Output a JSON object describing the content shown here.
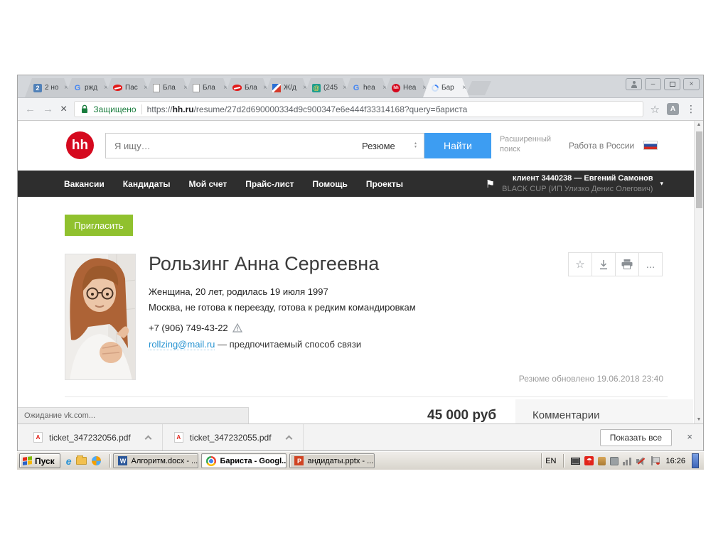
{
  "icons": {
    "close": "×",
    "star": "☆",
    "menu": "⋮",
    "flag": "⚑",
    "back": "←",
    "forward": "→",
    "caret_down": "▾",
    "spin_up": "▴",
    "spin_down": "▾",
    "minimize": "–",
    "more": "...",
    "g": "G",
    "at": "@",
    "hh": "hh",
    "e": "e",
    "w": "W",
    "p": "P",
    "a": "A",
    "badge2": "2",
    "umbrella": "☂",
    "scroll_up": "▲",
    "scroll_down": "▼"
  },
  "browser": {
    "tabs": [
      {
        "label": "2 но"
      },
      {
        "label": "ржд"
      },
      {
        "label": "Пас"
      },
      {
        "label": "Бла"
      },
      {
        "label": "Бла"
      },
      {
        "label": "Бла"
      },
      {
        "label": "Ж/д"
      },
      {
        "label": "(245"
      },
      {
        "label": "hea"
      },
      {
        "label": "Hea"
      },
      {
        "label": "Бар"
      }
    ],
    "address": {
      "security": "Защищено",
      "scheme": "https://",
      "host": "hh.ru",
      "path": "/resume/27d2d690000334d9c900347e6e444f33314168?query=бариста"
    },
    "status_text": "Ожидание vk.com..."
  },
  "hh": {
    "logo": "hh",
    "search_placeholder": "Я ищу…",
    "search_type": "Резюме",
    "search_button": "Найти",
    "advanced": "Расширенный поиск",
    "region": "Работа в России",
    "nav": [
      "Вакансии",
      "Кандидаты",
      "Мой счет",
      "Прайс-лист",
      "Помощь",
      "Проекты"
    ],
    "client_name": "клиент 3440238 — Евгений Самонов",
    "client_company": "BLACK CUP (ИП Улизко Денис Олегович)"
  },
  "resume": {
    "invite": "Пригласить",
    "name": "Рользинг Анна Сергеевна",
    "demographics": "Женщина, 20 лет, родилась 19 июля 1997",
    "location": "Москва, не готова к переезду, готова к редким командировкам",
    "phone": "+7 (906) 749-43-22",
    "email": "rollzing@mail.ru",
    "email_note": "— предпочитаемый способ связи",
    "updated": "Резюме обновлено 19.06.2018 23:40",
    "salary": "45 000 руб",
    "comments_title": "Комментарии"
  },
  "downloads": {
    "files": [
      {
        "name": "ticket_347232056.pdf"
      },
      {
        "name": "ticket_347232055.pdf"
      }
    ],
    "show_all": "Показать все"
  },
  "taskbar": {
    "start": "Пуск",
    "tasks": [
      {
        "title": "Алгоритм.docx - ..."
      },
      {
        "title": "Бариста - Googl..."
      },
      {
        "title": "андидаты.pptx - ..."
      }
    ],
    "lang": "EN",
    "time": "16:26"
  },
  "colors": {
    "accent_blue": "#3d9df2",
    "hh_red": "#d5091e",
    "invite_green": "#90c12e",
    "link_blue": "#2693d1",
    "secure_green": "#1a7d3e",
    "nav_dark": "#2e2e2e",
    "taskbar_grey": "#d8d4cc"
  }
}
